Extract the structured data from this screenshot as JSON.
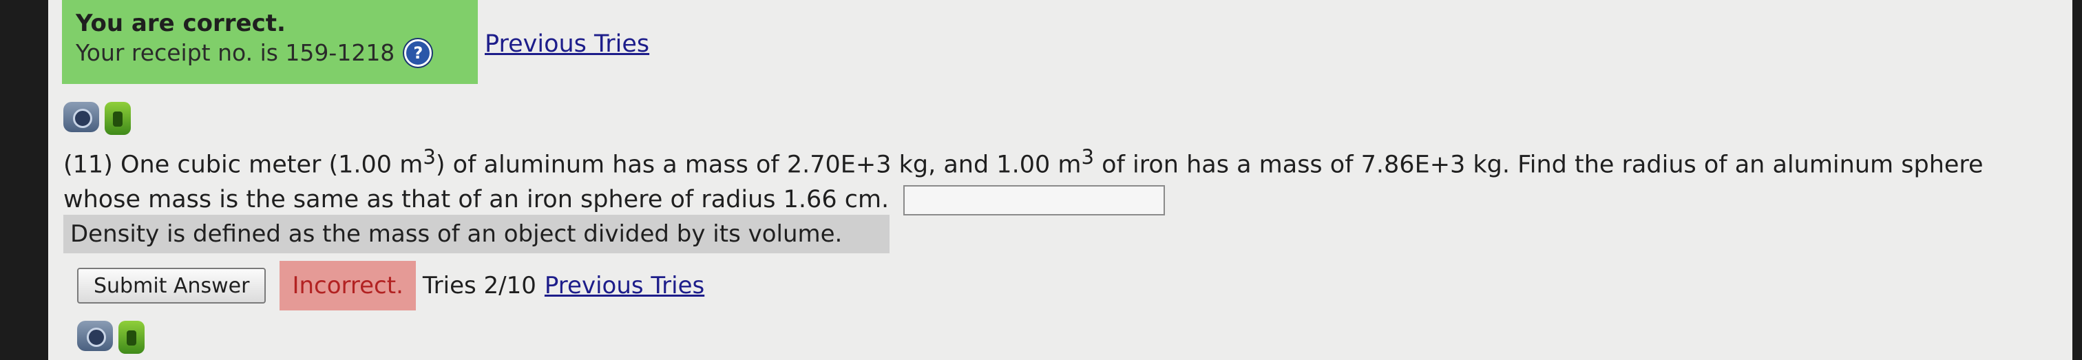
{
  "status": {
    "title": "You are correct.",
    "receipt": "Your receipt no. is 159-1218",
    "help_glyph": "?",
    "color": "#80cf6a"
  },
  "links": {
    "previous_tries_top": "Previous Tries",
    "previous_tries_bottom": "Previous Tries"
  },
  "icons": {
    "top": [
      "eye-icon",
      "thumbs-up-icon"
    ],
    "bottom": [
      "eye-icon",
      "thumbs-up-icon"
    ]
  },
  "question": {
    "part1": "(11) One cubic meter (1.00 m",
    "sup1": "3",
    "part2": ") of aluminum has a mass of 2.70E+3 kg, and 1.00 m",
    "sup2": "3",
    "part3": " of iron has a mass of 7.86E+3 kg. Find the radius of an aluminum sphere whose mass is the same as that of an iron sphere of radius 1.66 cm.",
    "answer_value": ""
  },
  "hint": "Density is defined as the mass of an object divided by its volume.",
  "controls": {
    "submit_label": "Submit Answer",
    "result": "Incorrect.",
    "result_color": "#e59a96",
    "tries": "Tries 2/10"
  }
}
